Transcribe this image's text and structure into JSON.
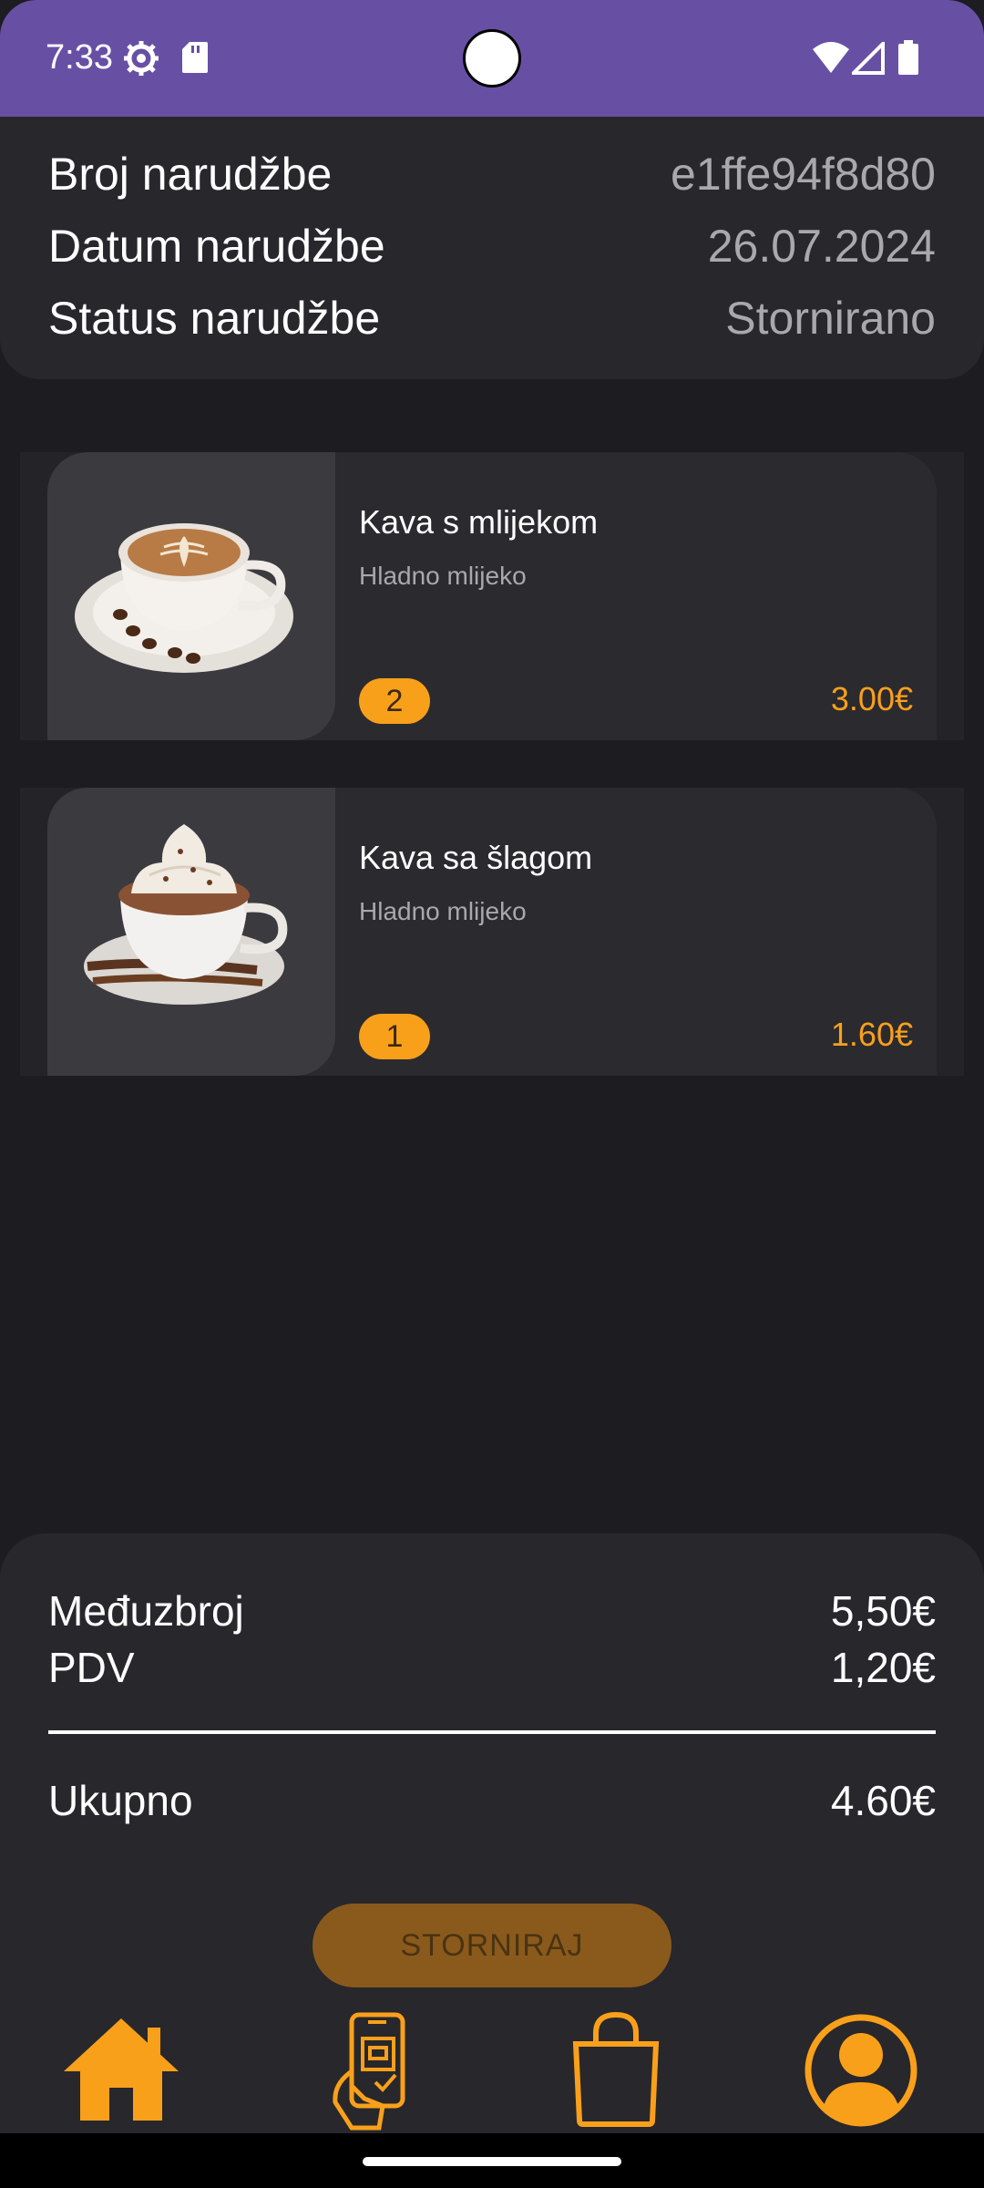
{
  "status_bar": {
    "time": "7:33",
    "icons": [
      "gear-icon",
      "sd-card-icon",
      "wifi-icon",
      "signal-icon",
      "battery-icon"
    ],
    "background": "#6750a4"
  },
  "order": {
    "number_label": "Broj narudžbe",
    "number_value": "e1ffe94f8d80",
    "date_label": "Datum narudžbe",
    "date_value": "26.07.2024",
    "status_label": "Status narudžbe",
    "status_value": "Stornirano"
  },
  "items": [
    {
      "name": "Kava s mlijekom",
      "description": "Hladno mlijeko",
      "quantity": "2",
      "price": "3.00€",
      "image": "latte-cup-image"
    },
    {
      "name": "Kava sa šlagom",
      "description": "Hladno mlijeko",
      "quantity": "1",
      "price": "1.60€",
      "image": "whipped-cream-coffee-image"
    }
  ],
  "summary": {
    "subtotal_label": "Međuzbroj",
    "subtotal_value": "5,50€",
    "vat_label": "PDV",
    "vat_value": "1,20€",
    "total_label": "Ukupno",
    "total_value": "4.60€"
  },
  "actions": {
    "cancel_label": "STORNIRAJ"
  },
  "bottom_nav": [
    "home-icon",
    "mobile-order-icon",
    "shopping-bag-icon",
    "profile-icon"
  ],
  "colors": {
    "accent": "#f9a01b",
    "background": "#1d1c21",
    "card": "#28272c"
  }
}
